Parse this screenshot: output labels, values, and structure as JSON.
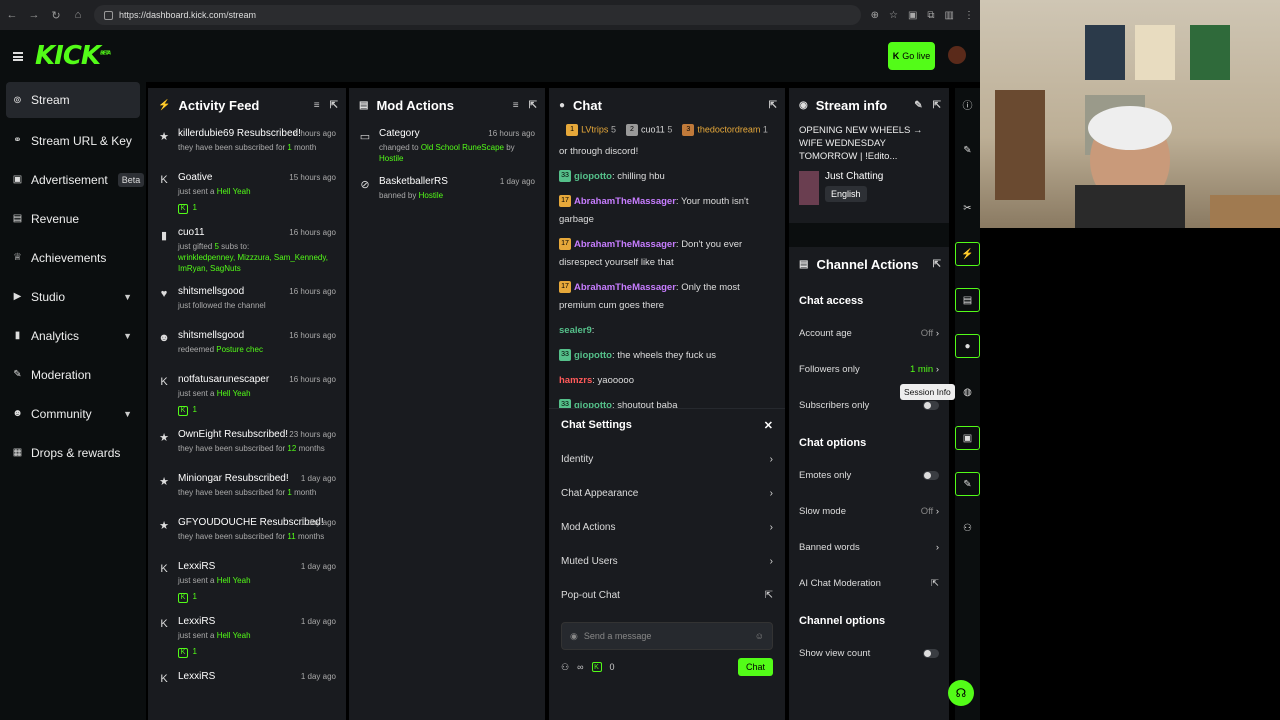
{
  "browser": {
    "url": "https://dashboard.kick.com/stream"
  },
  "brand": {
    "logo": "KICK",
    "beta": "BETA",
    "go_live": "Go live",
    "accent": "#53fc18"
  },
  "sidebar": {
    "items": [
      {
        "label": "Stream",
        "icon": "wave-icon"
      },
      {
        "label": "Stream URL & Key",
        "icon": "link-icon"
      },
      {
        "label": "Advertisement",
        "icon": "ad-icon",
        "badge": "Beta"
      },
      {
        "label": "Revenue",
        "icon": "chart-icon"
      },
      {
        "label": "Achievements",
        "icon": "trophy-icon"
      },
      {
        "label": "Studio",
        "icon": "video-icon"
      },
      {
        "label": "Analytics",
        "icon": "analytics-icon"
      },
      {
        "label": "Moderation",
        "icon": "wrench-icon"
      },
      {
        "label": "Community",
        "icon": "people-icon"
      },
      {
        "label": "Drops & rewards",
        "icon": "gift-icon"
      }
    ]
  },
  "activity_feed": {
    "title": "Activity Feed",
    "items": [
      {
        "name": "killerdubie69 Resubscribed!",
        "time": "8 hours ago",
        "sub": "they have been subscribed for",
        "hl": "1",
        "sub2": "month"
      },
      {
        "name": "Goative",
        "time": "15 hours ago",
        "sub": "just sent a",
        "hl": "Hell Yeah",
        "count": "1"
      },
      {
        "name": "cuo11",
        "time": "16 hours ago",
        "sub": "just gifted",
        "hl": "5",
        "sub2": "subs to:",
        "list": "wrinkledpenney, Mizzzura, Sam_Kennedy, ImRyan, SagNuts"
      },
      {
        "name": "shitsmellsgood",
        "time": "16 hours ago",
        "sub": "just followed the channel"
      },
      {
        "name": "shitsmellsgood",
        "time": "16 hours ago",
        "sub": "redeemed",
        "hl": "Posture chec"
      },
      {
        "name": "notfatusarunescaper",
        "time": "16 hours ago",
        "sub": "just sent a",
        "hl": "Hell Yeah",
        "count": "1"
      },
      {
        "name": "OwnEight Resubscribed!",
        "time": "23 hours ago",
        "sub": "they have been subscribed for",
        "hl": "12",
        "sub2": "months"
      },
      {
        "name": "Miniongar Resubscribed!",
        "time": "1 day ago",
        "sub": "they have been subscribed for",
        "hl": "1",
        "sub2": "month"
      },
      {
        "name": "GFYOUDOUCHE Resubscribed!",
        "time": "1 day ago",
        "sub": "they have been subscribed for",
        "hl": "11",
        "sub2": "months"
      },
      {
        "name": "LexxiRS",
        "time": "1 day ago",
        "sub": "just sent a",
        "hl": "Hell Yeah",
        "count": "1"
      },
      {
        "name": "LexxiRS",
        "time": "1 day ago",
        "sub": "just sent a",
        "hl": "Hell Yeah",
        "count": "1"
      },
      {
        "name": "LexxiRS",
        "time": "1 day ago",
        "sub": ""
      }
    ]
  },
  "mod_actions": {
    "title": "Mod Actions",
    "items": [
      {
        "name": "Category",
        "time": "16 hours ago",
        "sub": "changed to",
        "hl": "Old School RuneScape",
        "by": "by",
        "who": "Hostile"
      },
      {
        "name": "BasketballerRS",
        "time": "1 day ago",
        "sub": "banned by",
        "who": "Hostile"
      }
    ]
  },
  "chat": {
    "title": "Chat",
    "top_chatters": [
      {
        "name": "LVtrips",
        "count": "5"
      },
      {
        "name": "cuo11",
        "count": "5"
      },
      {
        "name": "thedoctordream",
        "count": "1"
      }
    ],
    "messages": [
      {
        "user": "",
        "text": "or through discord!"
      },
      {
        "badge": "33",
        "user": "giopotto",
        "text": "chilling hbu"
      },
      {
        "badge": "17",
        "user": "AbrahamTheMassager",
        "text": "Your mouth isn't garbage"
      },
      {
        "badge": "17",
        "user": "AbrahamTheMassager",
        "text": "Don't you ever disrespect yourself like that"
      },
      {
        "badge": "17",
        "user": "AbrahamTheMassager",
        "text": "Only the most premium cum goes there"
      },
      {
        "user": "sealer9",
        "text": ""
      },
      {
        "badge": "33",
        "user": "giopotto",
        "text": "the wheels they fuck us"
      },
      {
        "user": "hamzrs",
        "text": "yaooooo"
      },
      {
        "badge": "33",
        "user": "giopotto",
        "text": "shoutout baba"
      }
    ],
    "settings": {
      "title": "Chat Settings",
      "items": [
        "Identity",
        "Chat Appearance",
        "Mod Actions",
        "Muted Users",
        "Pop-out Chat"
      ]
    },
    "input_placeholder": "Send a message",
    "viewers": "∞",
    "kicks": "0",
    "send_label": "Chat"
  },
  "stream_info": {
    "title": "Stream info",
    "stream_title": "OPENING NEW WHEELS → WIFE WEDNESDAY TOMORROW | !Edito...",
    "category": "Just Chatting",
    "language": "English"
  },
  "channel_actions": {
    "title": "Channel Actions",
    "sections": [
      {
        "title": "Chat access",
        "rows": [
          {
            "label": "Account age",
            "value": "Off",
            "type": "arrow"
          },
          {
            "label": "Followers only",
            "value": "1 min",
            "type": "arrow",
            "green": true
          },
          {
            "label": "Subscribers only",
            "type": "toggle"
          }
        ]
      },
      {
        "title": "Chat options",
        "rows": [
          {
            "label": "Emotes only",
            "type": "toggle"
          },
          {
            "label": "Slow mode",
            "value": "Off",
            "type": "arrow"
          },
          {
            "label": "Banned words",
            "type": "arrow"
          },
          {
            "label": "AI Chat Moderation",
            "type": "external"
          }
        ]
      },
      {
        "title": "Channel options",
        "rows": [
          {
            "label": "Show view count",
            "type": "toggle"
          }
        ]
      }
    ]
  },
  "tooltip": "Session Info"
}
